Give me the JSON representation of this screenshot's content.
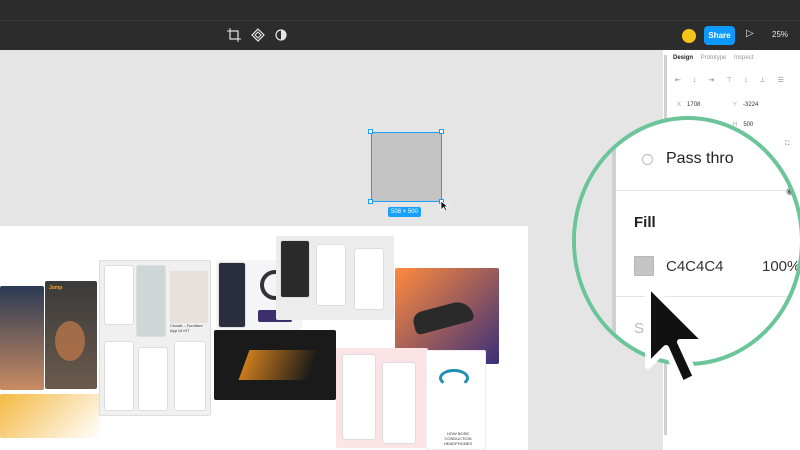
{
  "toolbar": {
    "icons": [
      "frame-icon",
      "component-icon",
      "contrast-icon"
    ],
    "avatar_initial": "",
    "share_label": "Share",
    "zoom": "25%"
  },
  "canvas": {
    "selection_dimensions": "508 × 500",
    "fill_color": "#c4c4c4",
    "accent": "#18a0fb"
  },
  "panel": {
    "tabs": [
      "Design",
      "Prototype",
      "Inspect"
    ],
    "x_label": "X",
    "x_value": "1708",
    "y_label": "Y",
    "y_value": "-3224",
    "w_label": "W",
    "w_value": "508",
    "h_label": "H",
    "h_value": "500",
    "rotation_value": "0"
  },
  "magnifier": {
    "layer_mode": "Pass thro",
    "fill_heading": "Fill",
    "fill_hex": "C4C4C4",
    "fill_opacity": "100%",
    "next_section": "S",
    "ring_color": "#6bc598"
  },
  "collage": {
    "app_title": "Jump",
    "product_title": "Chowit – Furniture App UI KIT",
    "headphones_caption": "HOW BOSE CONDUCTION HEADPHONES"
  }
}
